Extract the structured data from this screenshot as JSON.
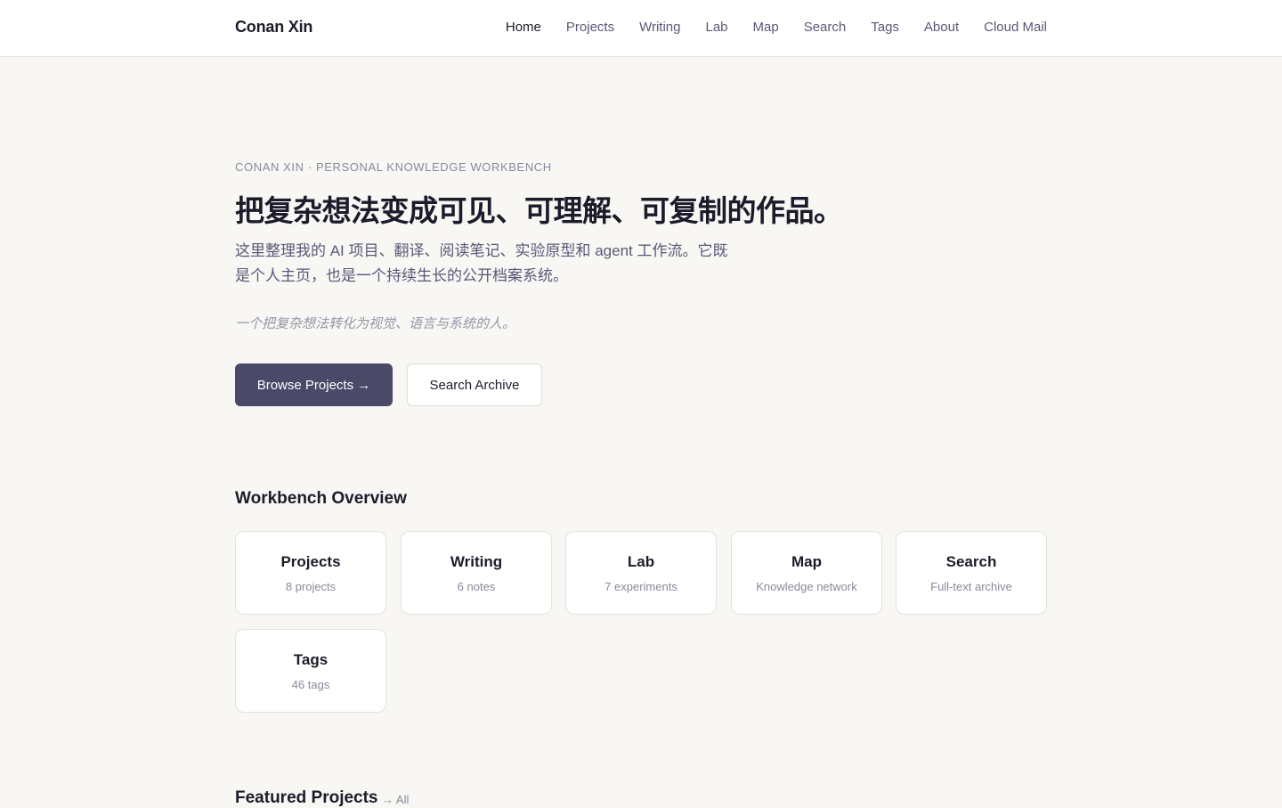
{
  "header": {
    "brand": "Conan Xin",
    "nav": [
      {
        "label": "Home",
        "active": true
      },
      {
        "label": "Projects"
      },
      {
        "label": "Writing"
      },
      {
        "label": "Lab"
      },
      {
        "label": "Map"
      },
      {
        "label": "Search"
      },
      {
        "label": "Tags"
      },
      {
        "label": "About"
      },
      {
        "label": "Cloud Mail"
      }
    ]
  },
  "hero": {
    "eyebrow": "CONAN XIN · PERSONAL KNOWLEDGE WORKBENCH",
    "headline": "把复杂想法变成可见、可理解、可复制的作品。",
    "lead": "这里整理我的 AI 项目、翻译、阅读笔记、实验原型和 agent 工作流。它既是个人主页，也是一个持续生长的公开档案系统。",
    "tagline": "一个把复杂想法转化为视觉、语言与系统的人。",
    "primary_button": "Browse Projects →",
    "secondary_button": "Search Archive"
  },
  "overview": {
    "title": "Workbench Overview",
    "cards": [
      {
        "title": "Projects",
        "sub": "8 projects"
      },
      {
        "title": "Writing",
        "sub": "6 notes"
      },
      {
        "title": "Lab",
        "sub": "7 experiments"
      },
      {
        "title": "Map",
        "sub": "Knowledge network"
      },
      {
        "title": "Search",
        "sub": "Full-text archive"
      },
      {
        "title": "Tags",
        "sub": "46 tags"
      }
    ]
  },
  "featured": {
    "title": "Featured Projects",
    "all_link": "→ All"
  },
  "colors": {
    "background": "#f8f7f4",
    "primary_button": "#4a4968",
    "nav_text": "#5a5877",
    "heading": "#1c1b2a"
  }
}
